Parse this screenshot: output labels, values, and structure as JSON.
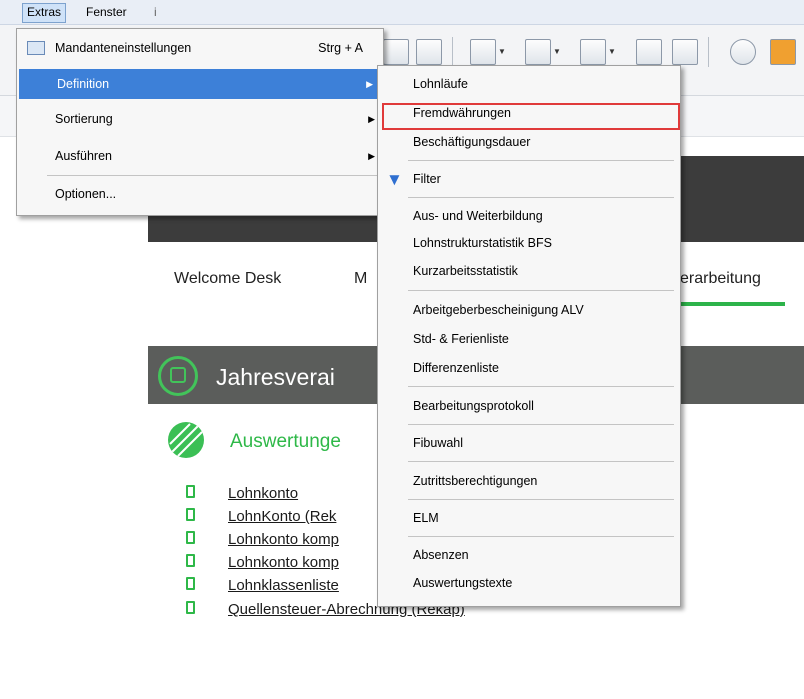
{
  "menubar": {
    "extras": "Extras",
    "fenster": "Fenster",
    "more": "i"
  },
  "nav": {
    "welcome": "Welcome Desk",
    "m": "M",
    "verarbeitung": "erarbeitung"
  },
  "section": {
    "title": "Jahresverai"
  },
  "auswertungen": {
    "title": "Auswertunge",
    "reports": [
      "Lohnkonto",
      "LohnKonto (Rek",
      "Lohnkonto komp",
      "Lohnkonto komp",
      "Lohnklassenliste",
      "Quellensteuer-Abrechnung (Rekap)"
    ]
  },
  "menu_extras": {
    "mandanten": "Mandanteneinstellungen",
    "mandanten_accel": "Strg + A",
    "definition": "Definition",
    "sortierung": "Sortierung",
    "ausfuehren": "Ausführen",
    "optionen": "Optionen..."
  },
  "menu_definition": {
    "lohnlaeufe": "Lohnläufe",
    "fremdwaehrungen": "Fremdwährungen",
    "beschaeftigungsdauer": "Beschäftigungsdauer",
    "filter": "Filter",
    "aus_weiterbildung": "Aus- und Weiterbildung",
    "lohnstruktur": "Lohnstrukturstatistik BFS",
    "kurzarbeit": "Kurzarbeitsstatistik",
    "arbeitgeber_alv": "Arbeitgeberbescheinigung ALV",
    "std_ferien": "Std- & Ferienliste",
    "differenzen": "Differenzenliste",
    "bearbeitung": "Bearbeitungsprotokoll",
    "fibuwahl": "Fibuwahl",
    "zutritt": "Zutrittsberechtigungen",
    "elm": "ELM",
    "absenzen": "Absenzen",
    "auswertungstexte": "Auswertungstexte"
  },
  "colors": {
    "highlight": "#3d80d8",
    "annotation": "#e03a3a",
    "accent_green": "#2eb848"
  }
}
